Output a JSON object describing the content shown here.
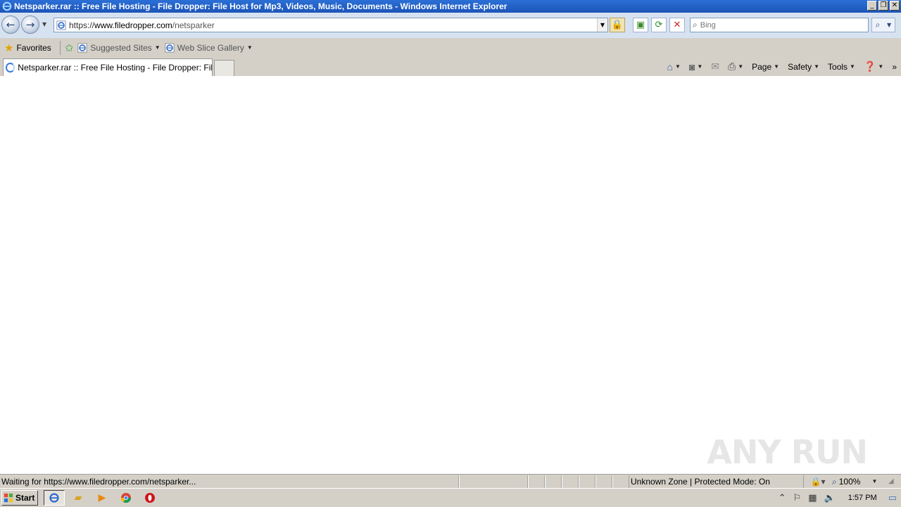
{
  "window": {
    "title": "Netsparker.rar :: Free File Hosting - File Dropper: File Host for Mp3, Videos, Music, Documents - Windows Internet Explorer"
  },
  "navbar": {
    "url_scheme": "https://",
    "url_domain": "www.filedropper.com",
    "url_path": "/netsparker",
    "search_placeholder": "Bing"
  },
  "favorites_bar": {
    "favorites_label": "Favorites",
    "items": [
      {
        "label": "Suggested Sites"
      },
      {
        "label": "Web Slice Gallery"
      }
    ]
  },
  "tabs": [
    {
      "label": "Netsparker.rar :: Free File Hosting - File Dropper: File ..."
    }
  ],
  "command_bar": {
    "page_label": "Page",
    "safety_label": "Safety",
    "tools_label": "Tools"
  },
  "statusbar": {
    "status_text": "Waiting for https://www.filedropper.com/netsparker...",
    "zone_text": "Unknown Zone | Protected Mode: On",
    "zoom_text": "100%"
  },
  "watermark": "ANY RUN",
  "taskbar": {
    "start_label": "Start",
    "clock": "1:57 PM"
  },
  "colors": {
    "titlebar": "#1c55b8",
    "chrome": "#d4d0c8",
    "navbar": "#d7e2f1"
  }
}
